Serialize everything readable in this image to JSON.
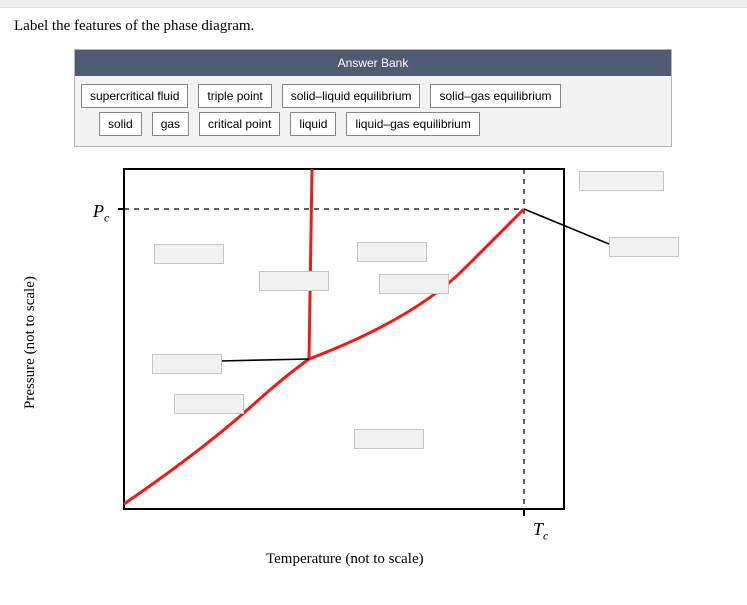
{
  "prompt": "Label the features of the phase diagram.",
  "answer_bank": {
    "title": "Answer Bank",
    "row1": [
      "supercritical fluid",
      "triple point",
      "solid–liquid equilibrium",
      "solid–gas equilibrium"
    ],
    "row2": [
      "solid",
      "gas",
      "critical point",
      "liquid",
      "liquid–gas equilibrium"
    ]
  },
  "axes": {
    "y": "Pressure (not to scale)",
    "x": "Temperature (not to scale)",
    "pc_base": "P",
    "pc_sub": "c",
    "tc_base": "T",
    "tc_sub": "c"
  }
}
